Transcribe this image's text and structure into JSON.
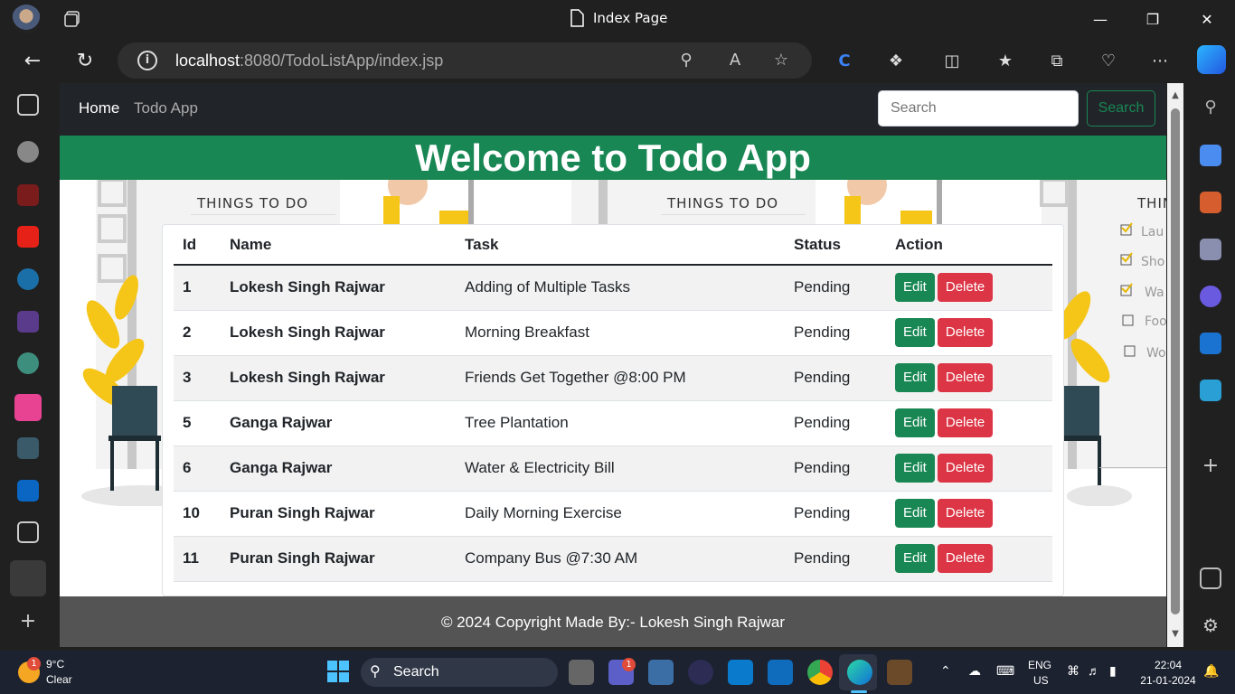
{
  "browser": {
    "window_title": "Index Page",
    "url_host": "localhost",
    "url_rest": ":8080/TodoListApp/index.jsp"
  },
  "site": {
    "nav": {
      "home": "Home",
      "brand": "Todo App"
    },
    "search": {
      "placeholder": "Search",
      "button": "Search"
    },
    "banner_title": "Welcome to Todo App",
    "bg_label": "THINGS TO DO",
    "bg_label_cut": "THIN",
    "bg_list_items": [
      "Lau",
      "Sho",
      "Wa",
      "Foo",
      "Wo"
    ],
    "table": {
      "headers": [
        "Id",
        "Name",
        "Task",
        "Status",
        "Action"
      ],
      "rows": [
        {
          "id": "1",
          "name": "Lokesh Singh Rajwar",
          "task": "Adding of Multiple Tasks",
          "status": "Pending"
        },
        {
          "id": "2",
          "name": "Lokesh Singh Rajwar",
          "task": "Morning Breakfast",
          "status": "Pending"
        },
        {
          "id": "3",
          "name": "Lokesh Singh Rajwar",
          "task": "Friends Get Together @8:00 PM",
          "status": "Pending"
        },
        {
          "id": "5",
          "name": "Ganga Rajwar",
          "task": "Tree Plantation",
          "status": "Pending"
        },
        {
          "id": "6",
          "name": "Ganga Rajwar",
          "task": "Water & Electricity Bill",
          "status": "Pending"
        },
        {
          "id": "10",
          "name": "Puran Singh Rajwar",
          "task": "Daily Morning Exercise",
          "status": "Pending"
        },
        {
          "id": "11",
          "name": "Puran Singh Rajwar",
          "task": "Company Bus @7:30 AM",
          "status": "Pending"
        }
      ],
      "edit_label": "Edit",
      "delete_label": "Delete"
    },
    "footer": "© 2024 Copyright Made By:- Lokesh Singh Rajwar"
  },
  "taskbar": {
    "weather_temp": "9°C",
    "weather_desc": "Clear",
    "weather_badge": "1",
    "search_label": "Search",
    "teams_badge": "1",
    "lang": "ENG",
    "region": "US",
    "time": "22:04",
    "date": "21-01-2024"
  },
  "colors": {
    "green": "#198754",
    "red": "#dc3545",
    "navbar": "#212529"
  }
}
